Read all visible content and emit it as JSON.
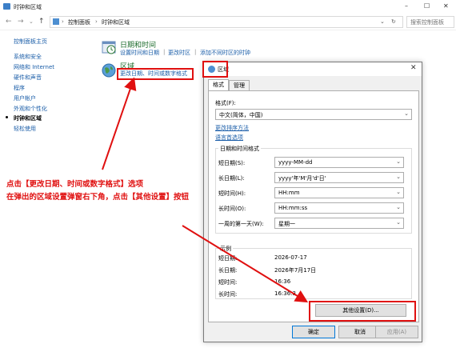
{
  "window": {
    "title": "时钟和区域",
    "controls": [
      "–",
      "☐",
      "✕"
    ]
  },
  "nav": {
    "crumbs": [
      "控制面板",
      "时钟和区域"
    ],
    "search_placeholder": "搜索控制面板"
  },
  "sidebar": {
    "items": [
      {
        "label": "控制面板主页",
        "active": false
      },
      {
        "label": "系统和安全",
        "active": false
      },
      {
        "label": "网络和 Internet",
        "active": false
      },
      {
        "label": "硬件和声音",
        "active": false
      },
      {
        "label": "程序",
        "active": false
      },
      {
        "label": "用户帐户",
        "active": false
      },
      {
        "label": "外观和个性化",
        "active": false
      },
      {
        "label": "时钟和区域",
        "active": true
      },
      {
        "label": "轻松使用",
        "active": false
      }
    ]
  },
  "categories": {
    "datetime": {
      "title": "日期和时间",
      "links": [
        "设置时间和日期",
        "更改时区",
        "添加不同时区的时钟"
      ]
    },
    "region": {
      "title": "区域",
      "link": "更改日期、时间或数字格式"
    }
  },
  "dialog": {
    "title": "区域",
    "tabs": [
      "格式",
      "管理"
    ],
    "format_label": "格式(F):",
    "format_value": "中文(简体，中国)",
    "link_sort": "更改排序方法",
    "link_lang": "语言首选项",
    "group_title": "日期和时间格式",
    "fields": [
      {
        "label": "短日期(S):",
        "value": "yyyy-MM-dd"
      },
      {
        "label": "长日期(L):",
        "value": "yyyy'年'M'月'd'日'"
      },
      {
        "label": "短时间(H):",
        "value": "HH:mm"
      },
      {
        "label": "长时间(O):",
        "value": "HH:mm:ss"
      },
      {
        "label": "一周的第一天(W):",
        "value": "星期一"
      }
    ],
    "examples_title": "示例",
    "examples": [
      {
        "label": "短日期:",
        "value": "2026-07-17"
      },
      {
        "label": "长日期:",
        "value": "2026年7月17日"
      },
      {
        "label": "短时间:",
        "value": "16:36"
      },
      {
        "label": "长时间:",
        "value": "16:36:3"
      }
    ],
    "btn_other": "其他设置(D)...",
    "btn_ok": "确定",
    "btn_cancel": "取消",
    "btn_apply": "应用(A)"
  },
  "annotation": {
    "line1": "点击【更改日期、时间或数字格式】选项",
    "line2": "在弹出的区域设置弹窗右下角，点击【其他设置】按钮",
    "color": "#e01010"
  }
}
